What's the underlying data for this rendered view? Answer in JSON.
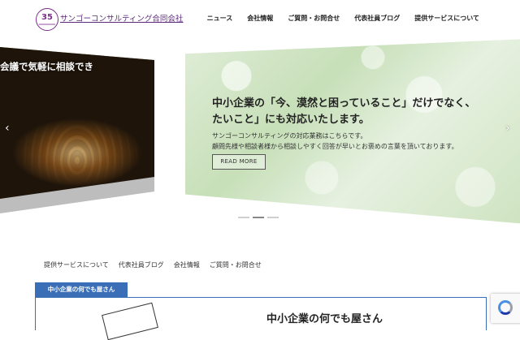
{
  "header": {
    "logo_number": "35",
    "site_title": "サンゴーコンサルティング合同会社",
    "nav": [
      "ニュース",
      "会社情報",
      "ご質問・お問合せ",
      "代表社員ブログ",
      "提供サービスについて"
    ]
  },
  "slider": {
    "left_slide_text": "会議で気軽に相談でき",
    "heading_line1": "中小企業の「今、漠然と困っていること」だけでなく、",
    "heading_line2": "たいこと」にも対応いたします。",
    "body_line1": "サンゴーコンサルティングの対応業務はこちらです。",
    "body_line2": "顧問先様や相談者様から相談しやすく回答が早いとお褒めの言葉を頂いております。",
    "read_more": "READ MORE",
    "prev_arrow": "‹",
    "next_arrow": "›",
    "active_dot": 2
  },
  "subnav": [
    "提供サービスについて",
    "代表社員ブログ",
    "会社情報",
    "ご質問・お問合せ"
  ],
  "section": {
    "tab_label": "中小企業の何でも屋さん",
    "heading": "中小企業の何でも屋さん"
  },
  "colors": {
    "accent": "#3a6fb7",
    "brand": "#7b2d8b"
  },
  "icons": {
    "recaptcha": "recaptcha-icon"
  }
}
